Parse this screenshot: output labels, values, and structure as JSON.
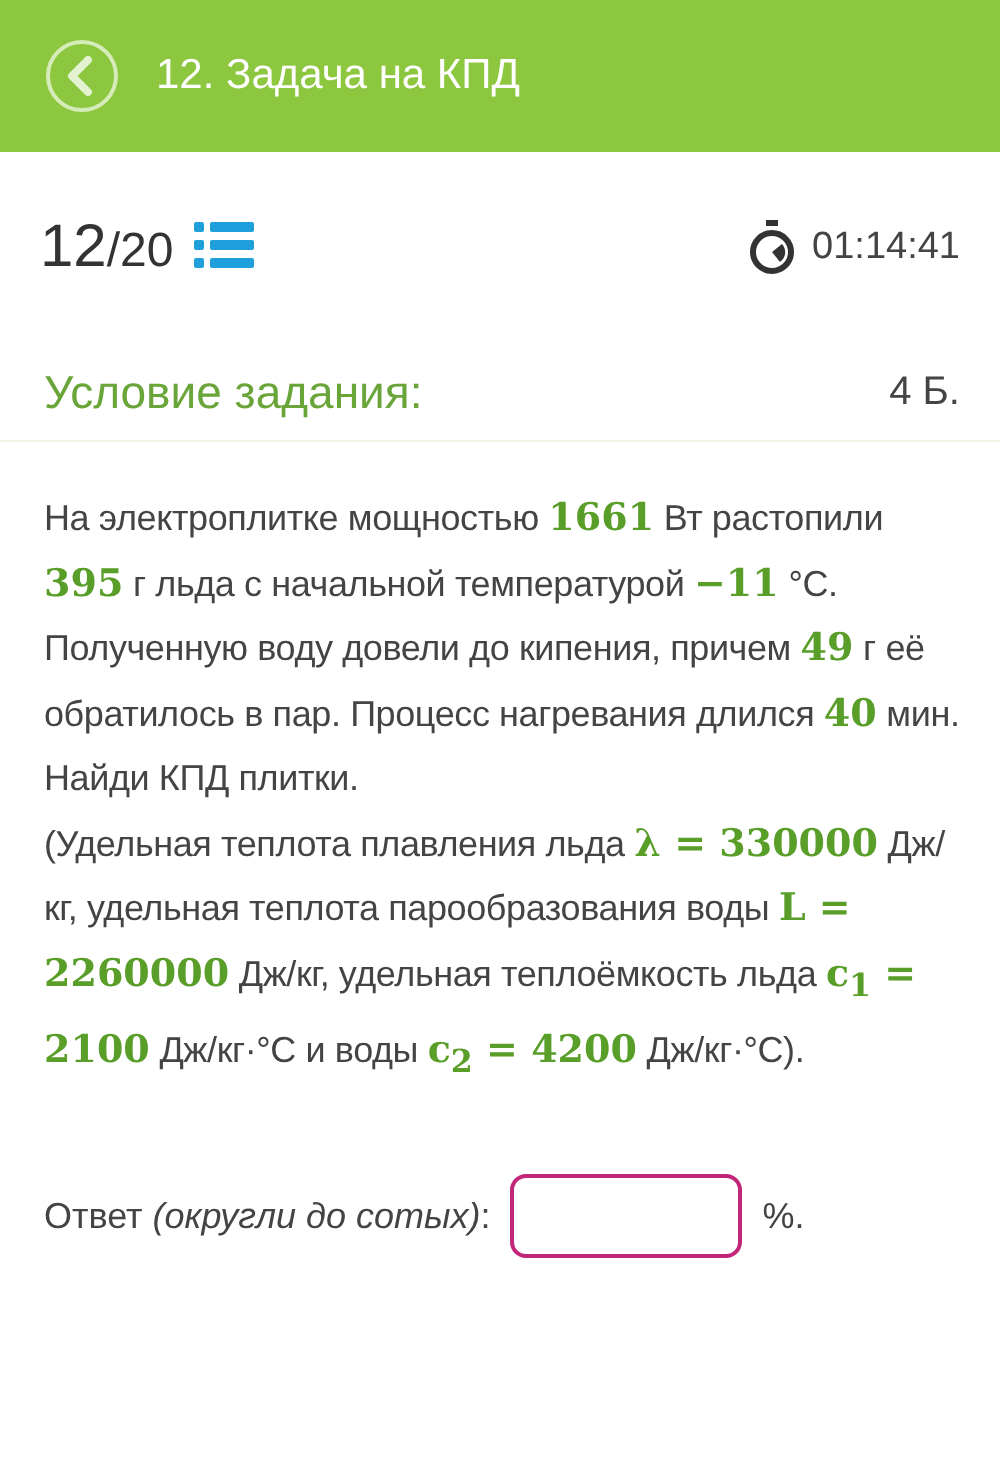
{
  "header": {
    "title": "12. Задача на КПД"
  },
  "progress": {
    "current": "12",
    "total": "/20"
  },
  "timer": "01:14:41",
  "task": {
    "heading": "Условие задания:",
    "points": "4 Б."
  },
  "paragraphs": [
    [
      {
        "kind": "text",
        "text": "На электроплитке мощностью "
      },
      {
        "kind": "math",
        "text": "1661"
      },
      {
        "kind": "text",
        "text": "  Вт растопили "
      },
      {
        "kind": "math",
        "text": "395"
      },
      {
        "kind": "text",
        "text": " г льда с начальной температурой "
      },
      {
        "kind": "math",
        "text": "−11"
      },
      {
        "kind": "text",
        "text": " °С. Полученную воду довели до кипения, причем "
      },
      {
        "kind": "math",
        "text": "49"
      },
      {
        "kind": "text",
        "text": " г её обратилось в пар. Процесс нагревания длился "
      },
      {
        "kind": "math",
        "text": "40"
      },
      {
        "kind": "text",
        "text": " мин. Найди КПД плитки."
      }
    ],
    [
      {
        "kind": "text",
        "text": "(Удельная теплота плавления льда "
      },
      {
        "kind": "math",
        "text": "λ = 330000"
      },
      {
        "kind": "text",
        "text": " Дж/кг, удельная теплота парообразования воды "
      },
      {
        "kind": "math",
        "text": "L = 2260000"
      },
      {
        "kind": "text",
        "text": " Дж/кг, удельная теплоёмкость льда "
      },
      {
        "kind": "math",
        "text": "c$_{1}$ = 2100"
      },
      {
        "kind": "text",
        "text": " Дж/кг·°С и воды "
      },
      {
        "kind": "math",
        "text": "c$_{2}$ = 4200"
      },
      {
        "kind": "text",
        "text": " Дж/кг·°С)."
      }
    ]
  ],
  "answer": {
    "label": "Ответ *(округли до сотых)*:",
    "unit": "%."
  }
}
